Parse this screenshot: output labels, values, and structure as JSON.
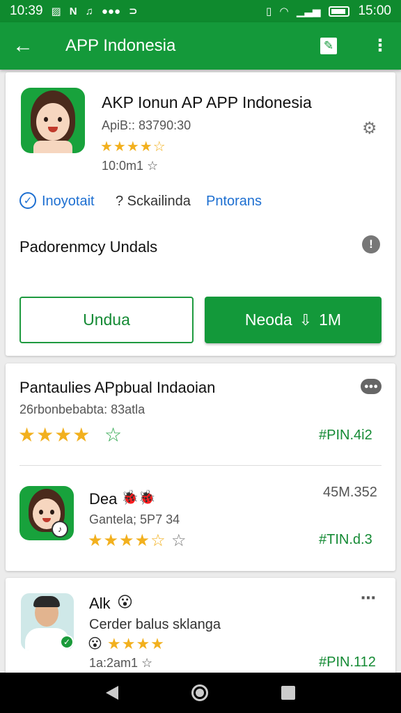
{
  "status_bar": {
    "time_left": "10:39",
    "time_right": "15:00",
    "left_icons": [
      "gallery-icon",
      "n-icon",
      "music-icon",
      "dots-icon",
      "link-icon"
    ],
    "right_icons": [
      "vibrate-icon",
      "wifi-icon",
      "signal-icon",
      "battery-icon"
    ]
  },
  "app_bar": {
    "title": "APP Indonesia",
    "back_icon": "←",
    "edit_icon": "✎",
    "more_icon": "⋮"
  },
  "app_card": {
    "title": "AKP Ionun AP APP Indonesia",
    "subtitle": "ApiB:: 83790:30",
    "rating_stars": "★★★★☆",
    "meta": "10:0m1 ☆",
    "verified_text": "Inoyotait",
    "info_text": "? Sckailinda",
    "info_link": "Pntorans",
    "section_label": "Padorenmcy Undals",
    "btn_secondary": "Undua",
    "btn_primary": "Neoda",
    "btn_primary_suffix": "1M",
    "colors": {
      "accent": "#14993a",
      "star": "#f2b01e"
    }
  },
  "review_card": {
    "header_title": "Pantaulies APpbual Indaoian",
    "header_sub": "26rbonbebabta: 83atla",
    "header_stars": "★★★★",
    "header_star_outline": "☆",
    "header_value": "#PIN.4i2",
    "item": {
      "name": "Dea",
      "badge": "🐞🐞",
      "sub": "Gantela; 5P7 34",
      "stars": "★★★★☆",
      "star_outline": "☆",
      "right_top": "45M.352",
      "right_bottom": "#TIN.d.3"
    }
  },
  "third_card": {
    "name": "Alk",
    "emoji": "😮",
    "sub": "Cerder balus sklanga",
    "emoji_star": "😮",
    "stars": "★★★★",
    "meta": "1a:2am1 ☆",
    "right_bottom": "#PIN.112",
    "more_icon": "⋯"
  }
}
